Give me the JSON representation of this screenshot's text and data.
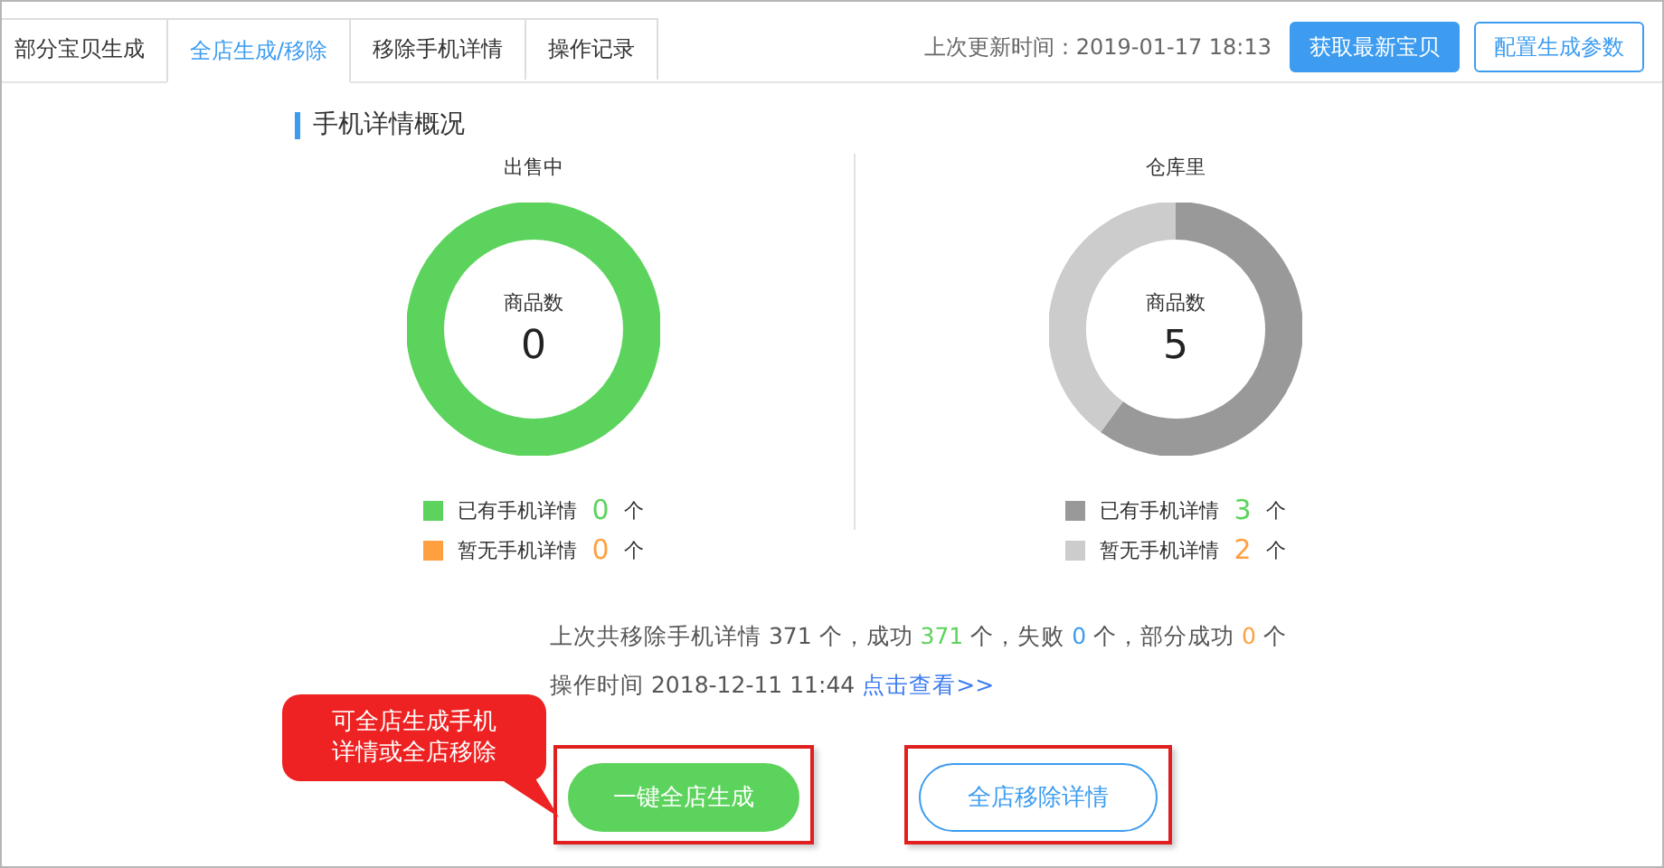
{
  "tabs": [
    {
      "label": "部分宝贝生成",
      "selected": false
    },
    {
      "label": "全店生成/移除",
      "selected": true
    },
    {
      "label": "移除手机详情",
      "selected": false
    },
    {
      "label": "操作记录",
      "selected": false
    }
  ],
  "update_time": "上次更新时间：2019-01-17 18:13",
  "header_buttons": [
    {
      "label": "获取最新宝贝",
      "kind": "primary"
    },
    {
      "label": "配置生成参数",
      "kind": "outline"
    }
  ],
  "section_title": "手机详情概况",
  "panels": [
    {
      "title": "出售中",
      "center_label": "商品数",
      "center_value": "0",
      "legend": [
        {
          "label": "已有手机详情",
          "count": "0",
          "unit": "个",
          "color": "#5cd35c"
        },
        {
          "label": "暂无手机详情",
          "count": "0",
          "unit": "个",
          "color": "#ffa040"
        }
      ]
    },
    {
      "title": "仓库里",
      "center_label": "商品数",
      "center_value": "5",
      "legend": [
        {
          "label": "已有手机详情",
          "count": "3",
          "unit": "个",
          "color": "#999999"
        },
        {
          "label": "暂无手机详情",
          "count": "2",
          "unit": "个",
          "color": "#cccccc"
        }
      ]
    }
  ],
  "summary": [
    {
      "text": "上次共移除手机详情 371 个，成功 ",
      "color": "#555555"
    },
    {
      "text": "371",
      "color": "#5cd35c"
    },
    {
      "text": " 个，失败 ",
      "color": "#555555"
    },
    {
      "text": "0",
      "color": "#3d9cf0"
    },
    {
      "text": " 个，部分成功 ",
      "color": "#555555"
    },
    {
      "text": "0",
      "color": "#ffa040"
    },
    {
      "text": " 个",
      "color": "#555555"
    }
  ],
  "operation_time": "操作时间 2018-12-11 11:44 ",
  "view_link": "点击查看>>",
  "actions": [
    {
      "label": "一键全店生成",
      "kind": "filled",
      "highlighted": true
    },
    {
      "label": "全店移除详情",
      "kind": "outline",
      "highlighted": true
    }
  ],
  "callout": "可全店生成手机详情或全店移除"
}
